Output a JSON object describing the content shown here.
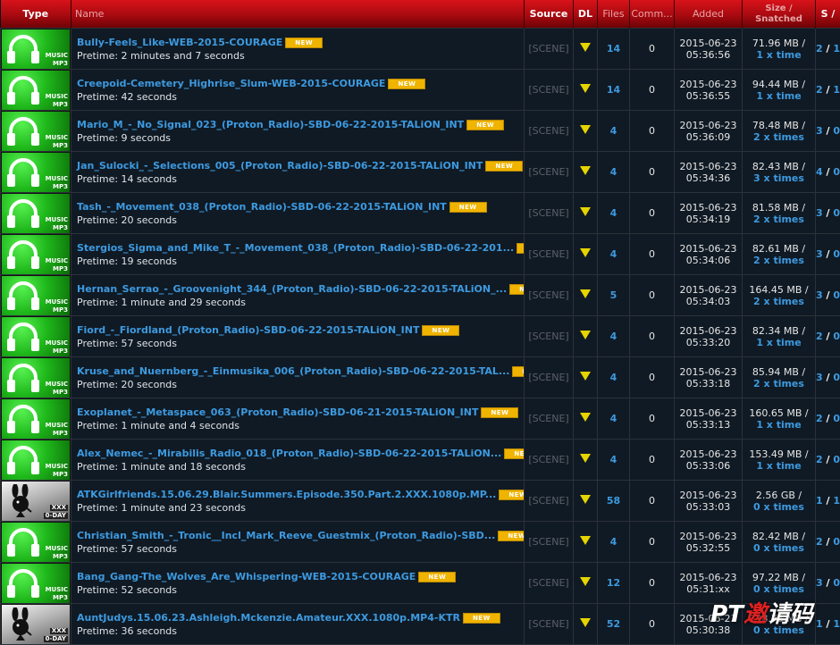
{
  "headers": {
    "type": "Type",
    "name": "Name",
    "source": "Source",
    "dl": "DL",
    "files": "Files",
    "comments": "Comm...",
    "added": "Added",
    "size_top": "Size /",
    "size_bottom": "Snatched",
    "sl": "S /"
  },
  "badges": {
    "new": "NEW",
    "music_top": "MUSIC",
    "music_bottom": "MP3",
    "xxx_top": "XXX",
    "xxx_bottom": "0-DAY"
  },
  "rows": [
    {
      "icon": "music",
      "name": "Bully-Feels_Like-WEB-2015-COURAGE",
      "pretime": "Pretime: 2 minutes and 7 seconds",
      "source": "[SCENE]",
      "files": "14",
      "comments": "0",
      "date": "2015-06-23",
      "time": "05:36:56",
      "size": "71.96 MB /",
      "snatched": "1 x time",
      "seeders": "2",
      "leechers": "1"
    },
    {
      "icon": "music",
      "name": "Creepoid-Cemetery_Highrise_Slum-WEB-2015-COURAGE",
      "pretime": "Pretime: 42 seconds",
      "source": "[SCENE]",
      "files": "14",
      "comments": "0",
      "date": "2015-06-23",
      "time": "05:36:55",
      "size": "94.44 MB /",
      "snatched": "1 x time",
      "seeders": "2",
      "leechers": "1"
    },
    {
      "icon": "music",
      "name": "Mario_M_-_No_Signal_023_(Proton_Radio)-SBD-06-22-2015-TALiON_INT",
      "pretime": "Pretime: 9 seconds",
      "source": "[SCENE]",
      "files": "4",
      "comments": "0",
      "date": "2015-06-23",
      "time": "05:36:09",
      "size": "78.48 MB /",
      "snatched": "2 x times",
      "seeders": "3",
      "leechers": "0"
    },
    {
      "icon": "music",
      "name": "Jan_Sulocki_-_Selections_005_(Proton_Radio)-SBD-06-22-2015-TALiON_INT",
      "pretime": "Pretime: 14 seconds",
      "source": "[SCENE]",
      "files": "4",
      "comments": "0",
      "date": "2015-06-23",
      "time": "05:34:36",
      "size": "82.43 MB /",
      "snatched": "3 x times",
      "seeders": "4",
      "leechers": "0"
    },
    {
      "icon": "music",
      "name": "Tash_-_Movement_038_(Proton_Radio)-SBD-06-22-2015-TALiON_INT",
      "pretime": "Pretime: 20 seconds",
      "source": "[SCENE]",
      "files": "4",
      "comments": "0",
      "date": "2015-06-23",
      "time": "05:34:19",
      "size": "81.58 MB /",
      "snatched": "2 x times",
      "seeders": "3",
      "leechers": "0"
    },
    {
      "icon": "music",
      "name": "Stergios_Sigma_and_Mike_T_-_Movement_038_(Proton_Radio)-SBD-06-22-201...",
      "pretime": "Pretime: 19 seconds",
      "source": "[SCENE]",
      "files": "4",
      "comments": "0",
      "date": "2015-06-23",
      "time": "05:34:06",
      "size": "82.61 MB /",
      "snatched": "2 x times",
      "seeders": "3",
      "leechers": "0"
    },
    {
      "icon": "music",
      "name": "Hernan_Serrao_-_Groovenight_344_(Proton_Radio)-SBD-06-22-2015-TALiON_...",
      "pretime": "Pretime: 1 minute and 29 seconds",
      "source": "[SCENE]",
      "files": "5",
      "comments": "0",
      "date": "2015-06-23",
      "time": "05:34:03",
      "size": "164.45 MB /",
      "snatched": "2 x times",
      "seeders": "3",
      "leechers": "0"
    },
    {
      "icon": "music",
      "name": "Fiord_-_Fiordland_(Proton_Radio)-SBD-06-22-2015-TALiON_INT",
      "pretime": "Pretime: 57 seconds",
      "source": "[SCENE]",
      "files": "4",
      "comments": "0",
      "date": "2015-06-23",
      "time": "05:33:20",
      "size": "82.34 MB /",
      "snatched": "1 x time",
      "seeders": "2",
      "leechers": "0"
    },
    {
      "icon": "music",
      "name": "Kruse_and_Nuernberg_-_Einmusika_006_(Proton_Radio)-SBD-06-22-2015-TAL...",
      "pretime": "Pretime: 20 seconds",
      "source": "[SCENE]",
      "files": "4",
      "comments": "0",
      "date": "2015-06-23",
      "time": "05:33:18",
      "size": "85.94 MB /",
      "snatched": "2 x times",
      "seeders": "3",
      "leechers": "0"
    },
    {
      "icon": "music",
      "name": "Exoplanet_-_Metaspace_063_(Proton_Radio)-SBD-06-21-2015-TALiON_INT",
      "pretime": "Pretime: 1 minute and 4 seconds",
      "source": "[SCENE]",
      "files": "4",
      "comments": "0",
      "date": "2015-06-23",
      "time": "05:33:13",
      "size": "160.65 MB /",
      "snatched": "1 x time",
      "seeders": "2",
      "leechers": "0"
    },
    {
      "icon": "music",
      "name": "Alex_Nemec_-_Mirabilis_Radio_018_(Proton_Radio)-SBD-06-22-2015-TALiON...",
      "pretime": "Pretime: 1 minute and 18 seconds",
      "source": "[SCENE]",
      "files": "4",
      "comments": "0",
      "date": "2015-06-23",
      "time": "05:33:06",
      "size": "153.49 MB /",
      "snatched": "1 x time",
      "seeders": "2",
      "leechers": "0"
    },
    {
      "icon": "xxx",
      "name": "ATKGirlfriends.15.06.29.Blair.Summers.Episode.350.Part.2.XXX.1080p.MP...",
      "pretime": "Pretime: 1 minute and 23 seconds",
      "source": "[SCENE]",
      "files": "58",
      "comments": "0",
      "date": "2015-06-23",
      "time": "05:33:03",
      "size": "2.56 GB /",
      "snatched": "0 x times",
      "seeders": "1",
      "leechers": "1"
    },
    {
      "icon": "music",
      "name": "Christian_Smith_-_Tronic__Incl_Mark_Reeve_Guestmix_(Proton_Radio)-SBD...",
      "pretime": "Pretime: 57 seconds",
      "source": "[SCENE]",
      "files": "4",
      "comments": "0",
      "date": "2015-06-23",
      "time": "05:32:55",
      "size": "82.42 MB /",
      "snatched": "0 x times",
      "seeders": "2",
      "leechers": "0"
    },
    {
      "icon": "music",
      "name": "Bang_Gang-The_Wolves_Are_Whispering-WEB-2015-COURAGE",
      "pretime": "Pretime: 52 seconds",
      "source": "[SCENE]",
      "files": "12",
      "comments": "0",
      "date": "2015-06-23",
      "time": "05:31:xx",
      "size": "97.22 MB /",
      "snatched": "0 x times",
      "seeders": "3",
      "leechers": "0"
    },
    {
      "icon": "xxx",
      "name": "AuntJudys.15.06.23.Ashleigh.Mckenzie.Amateur.XXX.1080p.MP4-KTR",
      "pretime": "Pretime: 36 seconds",
      "source": "[SCENE]",
      "files": "52",
      "comments": "0",
      "date": "2015-06-23",
      "time": "05:30:38",
      "size": "138.73 MB /",
      "snatched": "0 x times",
      "seeders": "1",
      "leechers": "1"
    }
  ],
  "watermark": {
    "left": "PT",
    "mid": "邀",
    "right": "请码"
  }
}
